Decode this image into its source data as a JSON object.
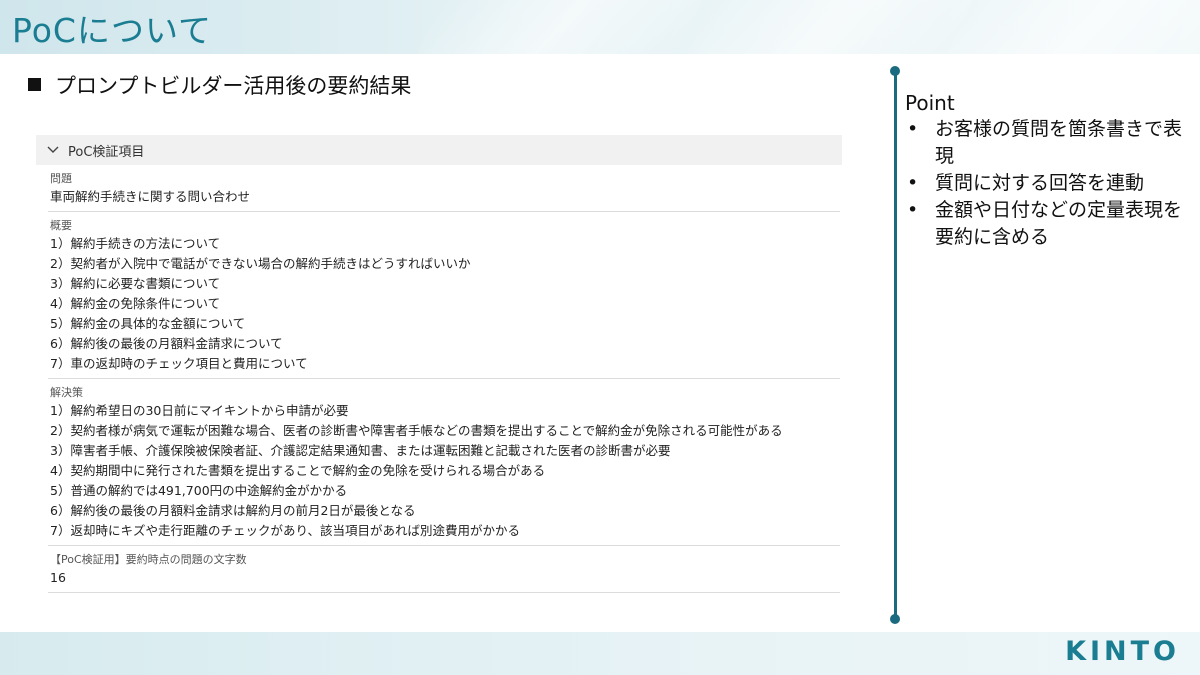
{
  "header": {
    "title": "PoCについて"
  },
  "section": {
    "heading": "プロンプトビルダー活用後の要約結果"
  },
  "panel": {
    "title": "PoC検証項目",
    "fields": {
      "problem": {
        "label": "問題",
        "value": "車両解約手続きに関する問い合わせ"
      },
      "summary": {
        "label": "概要",
        "items": [
          "1）解約手続きの方法について",
          "2）契約者が入院中で電話ができない場合の解約手続きはどうすればいいか",
          "3）解約に必要な書類について",
          "4）解約金の免除条件について",
          "5）解約金の具体的な金額について",
          "6）解約後の最後の月額料金請求について",
          "7）車の返却時のチェック項目と費用について"
        ]
      },
      "solution": {
        "label": "解決策",
        "items": [
          "1）解約希望日の30日前にマイキントから申請が必要",
          "2）契約者様が病気で運転が困難な場合、医者の診断書や障害者手帳などの書類を提出することで解約金が免除される可能性がある",
          "3）障害者手帳、介護保険被保険者証、介護認定結果通知書、または運転困難と記載された医者の診断書が必要",
          "4）契約期間中に発行された書類を提出することで解約金の免除を受けられる場合がある",
          "5）普通の解約では491,700円の中途解約金がかかる",
          "6）解約後の最後の月額料金請求は解約月の前月2日が最後となる",
          "7）返却時にキズや走行距離のチェックがあり、該当項目があれば別途費用がかかる"
        ]
      },
      "char_count": {
        "label": "【PoC検証用】要約時点の問題の文字数",
        "value": "16"
      }
    }
  },
  "point": {
    "title": "Point",
    "items": [
      "お客様の質問を箇条書きで表現",
      "質問に対する回答を連動",
      "金額や日付などの定量表現を要約に含める"
    ]
  },
  "logo": {
    "text": "KINTO"
  },
  "colors": {
    "accent": "#1a7d92",
    "divider": "#1a6a80"
  }
}
